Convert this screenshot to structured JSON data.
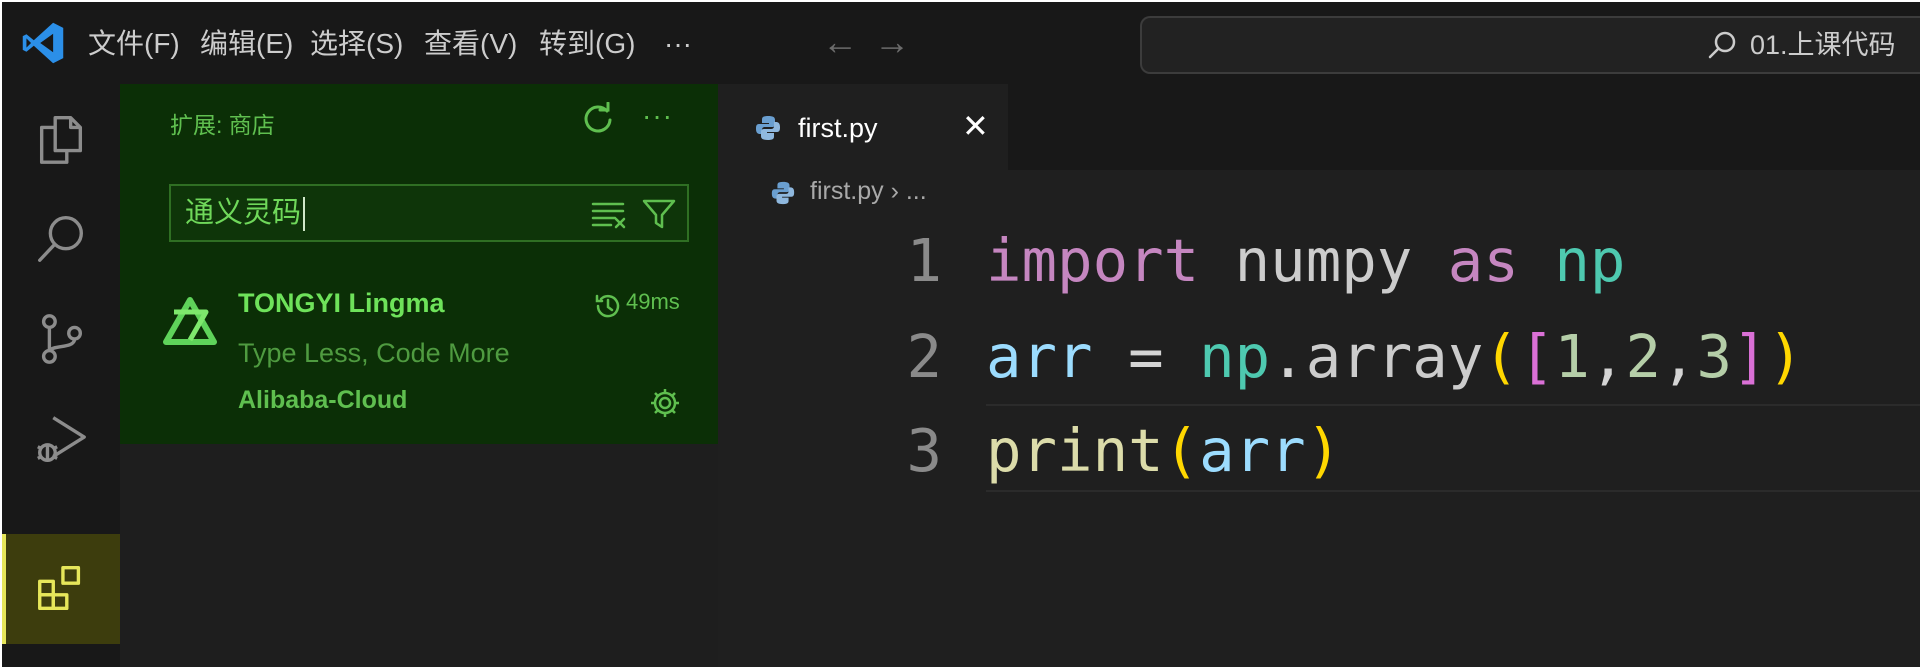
{
  "menu": [
    "文件(F)",
    "编辑(E)",
    "选择(S)",
    "查看(V)",
    "转到(G)",
    "···"
  ],
  "nav": {
    "back_icon": "arrow-left-icon",
    "forward_icon": "arrow-right-icon"
  },
  "search": {
    "text": "01.上课代码"
  },
  "activity_bar": [
    "explorer-icon",
    "search-icon",
    "source-control-icon",
    "run-debug-icon",
    "extensions-icon"
  ],
  "sidebar": {
    "title": "扩展: 商店",
    "more": "···",
    "search_value": "通义灵码",
    "extension": {
      "name": "TONGYI Lingma",
      "time": "49ms",
      "description": "Type Less, Code More",
      "publisher": "Alibaba-Cloud"
    }
  },
  "editor": {
    "tab_label": "first.py",
    "tab_close": "✕",
    "breadcrumb": "first.py › ...",
    "line_numbers": [
      "1",
      "2",
      "3"
    ],
    "code": {
      "l1": [
        "import",
        " numpy ",
        "as",
        " np"
      ],
      "l2": [
        "arr",
        " = ",
        "np",
        ".",
        "array",
        "(",
        "[",
        "1",
        ",",
        "2",
        ",",
        "3",
        "]",
        ")"
      ],
      "l3": [
        "print",
        "(",
        "arr",
        ")"
      ]
    }
  },
  "colors": {
    "accent_green": "#6ee25a",
    "keyword": "#c586c0",
    "module": "#4ec9b0",
    "variable": "#9cdcfe",
    "function": "#dcdcaa",
    "bracket_gold": "#ffd700",
    "bracket_violet": "#da70d6",
    "number": "#b5cea8"
  }
}
